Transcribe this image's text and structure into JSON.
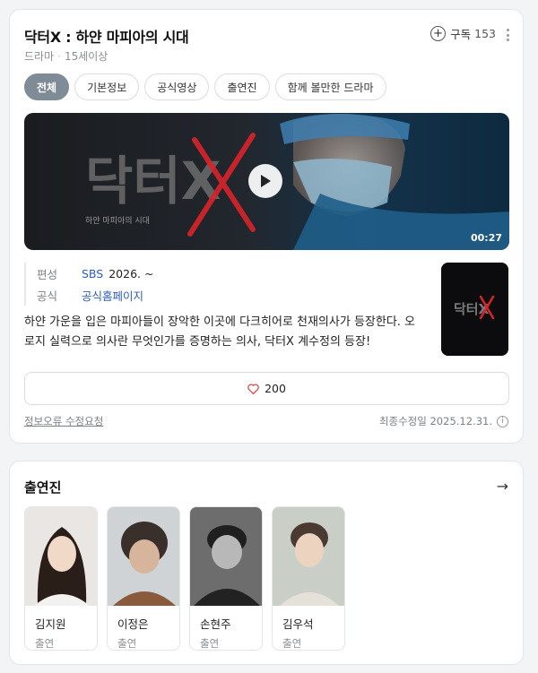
{
  "show": {
    "title": "닥터X : 하얀 마피아의 시대",
    "genre": "드라마",
    "rating": "15세이상",
    "subscribe_label": "구독",
    "subscribe_count": "153"
  },
  "tabs": [
    {
      "label": "전체",
      "active": true
    },
    {
      "label": "기본정보",
      "active": false
    },
    {
      "label": "공식영상",
      "active": false
    },
    {
      "label": "출연진",
      "active": false
    },
    {
      "label": "함께 볼만한 드라마",
      "active": false
    }
  ],
  "video": {
    "duration": "00:27",
    "logo_text": "닥터X",
    "tagline": "하얀    마피아의    시대"
  },
  "meta": {
    "broadcast_label": "편성",
    "broadcaster": "SBS",
    "year": "2026. ~",
    "official_label": "공식",
    "official_link": "공식홈페이지"
  },
  "description": "하얀 가운을 입은 마피아들이 장악한 이곳에 다크히어로 천재의사가 등장한다. 오로지 실력으로 의사란 무엇인가를 증명하는 의사, 닥터X 계수정의 등장!",
  "poster_logo": "닥터X",
  "like_count": "200",
  "footer": {
    "report": "정보오류 수정요청",
    "updated": "최종수정일 2025.12.31."
  },
  "cast": {
    "title": "출연진",
    "members": [
      {
        "name": "김지원",
        "role": "출연"
      },
      {
        "name": "이정은",
        "role": "출연"
      },
      {
        "name": "손현주",
        "role": "출연"
      },
      {
        "name": "김우석",
        "role": "출연"
      }
    ]
  },
  "colors": {
    "accent_link": "#2c5cc5",
    "active_tab": "#7f8c97",
    "video_red": "#d8232a"
  },
  "icons": [
    "plus-circle-icon",
    "kebab-icon",
    "play-icon",
    "heart-icon",
    "info-icon",
    "arrow-right-icon"
  ]
}
